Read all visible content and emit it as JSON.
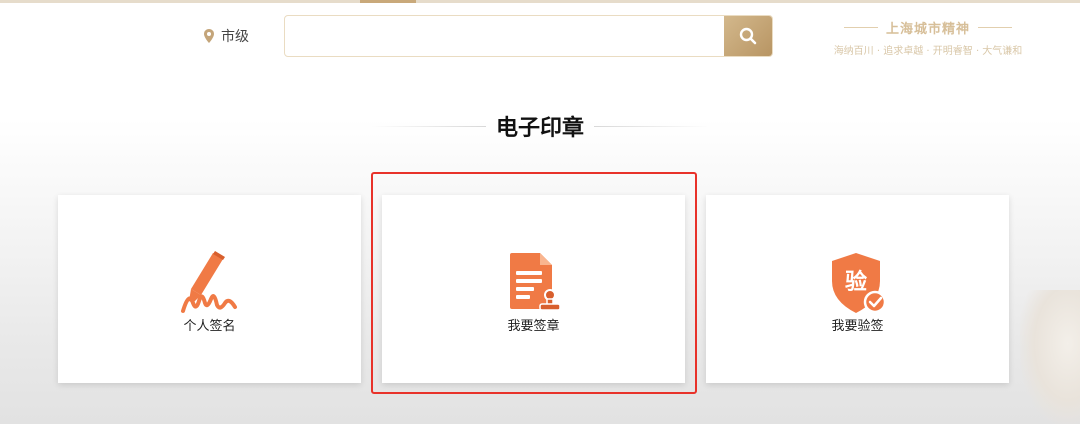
{
  "header": {
    "location_label": "市级",
    "search": {
      "value": "",
      "placeholder": ""
    },
    "slogan": {
      "title": "上海城市精神",
      "subtitle": "海纳百川 · 追求卓越 · 开明睿智 · 大气谦和"
    }
  },
  "section": {
    "title": "电子印章"
  },
  "cards": [
    {
      "label": "个人签名",
      "icon": "pen-signature-icon"
    },
    {
      "label": "我要签章",
      "icon": "document-stamp-icon"
    },
    {
      "label": "我要验签",
      "icon": "shield-verify-icon",
      "icon_text": "验"
    }
  ],
  "colors": {
    "accent": "#f07a45",
    "gold": "#c9a97a",
    "highlight": "#e8322a"
  }
}
